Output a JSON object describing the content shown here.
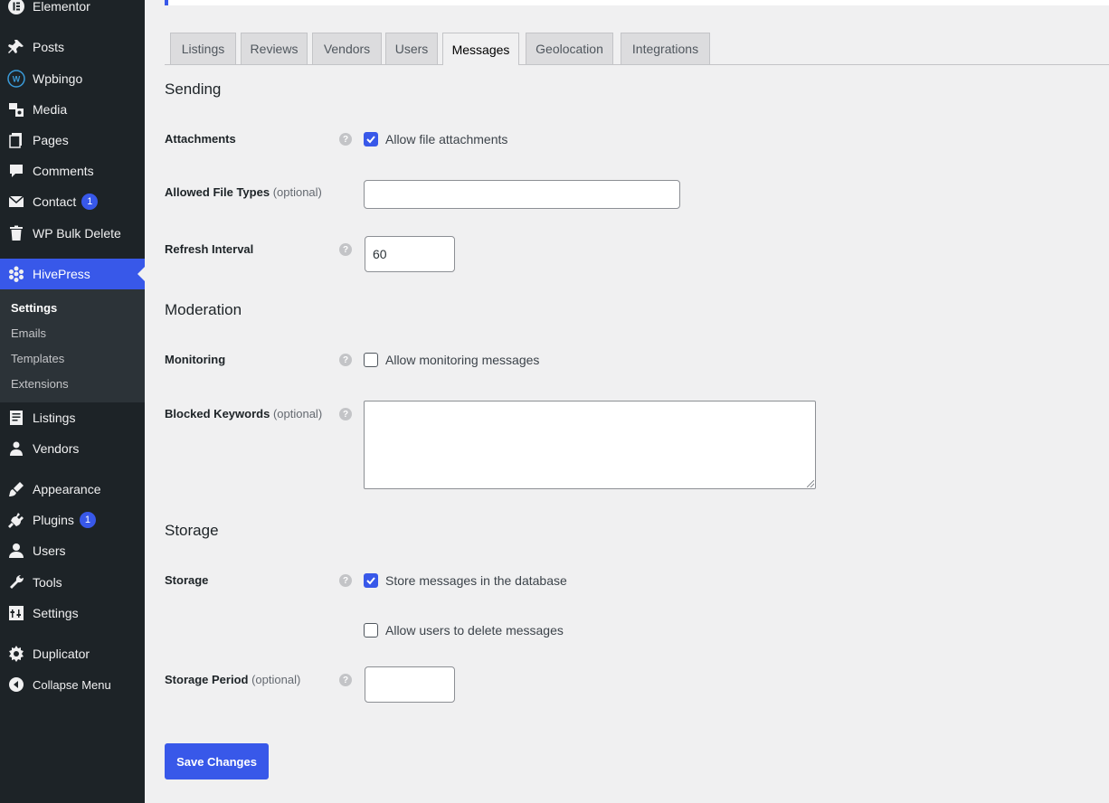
{
  "sidebar": {
    "items": [
      {
        "label": "Elementor",
        "icon": "elementor-icon"
      },
      {
        "label": "Posts",
        "icon": "pin-icon"
      },
      {
        "label": "Wpbingo",
        "icon": "wpbingo-icon"
      },
      {
        "label": "Media",
        "icon": "media-icon"
      },
      {
        "label": "Pages",
        "icon": "pages-icon"
      },
      {
        "label": "Comments",
        "icon": "comment-icon"
      },
      {
        "label": "Contact",
        "icon": "mail-icon",
        "badge": "1"
      },
      {
        "label": "WP Bulk Delete",
        "icon": "trash-icon"
      },
      {
        "label": "HivePress",
        "icon": "hivepress-icon"
      },
      {
        "label": "Listings",
        "icon": "listings-icon"
      },
      {
        "label": "Vendors",
        "icon": "vendors-icon"
      },
      {
        "label": "Appearance",
        "icon": "brush-icon"
      },
      {
        "label": "Plugins",
        "icon": "plugin-icon",
        "badge": "1"
      },
      {
        "label": "Users",
        "icon": "user-icon"
      },
      {
        "label": "Tools",
        "icon": "wrench-icon"
      },
      {
        "label": "Settings",
        "icon": "settings-icon"
      },
      {
        "label": "Duplicator",
        "icon": "duplicator-icon"
      },
      {
        "label": "Collapse Menu",
        "icon": "collapse-icon"
      }
    ],
    "submenu": [
      "Settings",
      "Emails",
      "Templates",
      "Extensions"
    ]
  },
  "tabs": [
    "Listings",
    "Reviews",
    "Vendors",
    "Users",
    "Messages",
    "Geolocation",
    "Integrations"
  ],
  "active_tab": "Messages",
  "sections": {
    "sending": "Sending",
    "moderation": "Moderation",
    "storage": "Storage"
  },
  "fields": {
    "attachments": {
      "label": "Attachments",
      "checkbox": "Allow file attachments",
      "checked": true
    },
    "allowed_file_types": {
      "label": "Allowed File Types",
      "optional": "(optional)",
      "value": ""
    },
    "refresh_interval": {
      "label": "Refresh Interval",
      "value": "60"
    },
    "monitoring": {
      "label": "Monitoring",
      "checkbox": "Allow monitoring messages",
      "checked": false
    },
    "blocked_keywords": {
      "label": "Blocked Keywords",
      "optional": "(optional)",
      "value": ""
    },
    "storage": {
      "label": "Storage",
      "checkbox": "Store messages in the database",
      "checked": true,
      "checkbox2": "Allow users to delete messages",
      "checked2": false
    },
    "storage_period": {
      "label": "Storage Period",
      "optional": "(optional)",
      "value": ""
    }
  },
  "save_button": "Save Changes",
  "colors": {
    "accent": "#3858e9",
    "sidebar": "#1d2327",
    "background": "#f0f0f1"
  }
}
